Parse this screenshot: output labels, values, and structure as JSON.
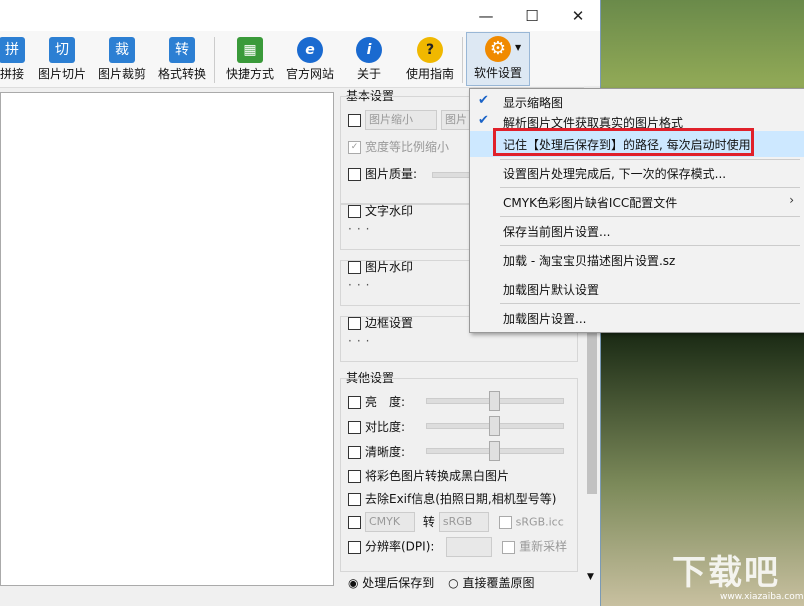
{
  "window": {
    "minimize": "—",
    "maximize": "☐",
    "close": "✕"
  },
  "toolbar": {
    "items": [
      {
        "label": "拼接",
        "icon": "拼",
        "color": "#2c7fd3"
      },
      {
        "label": "图片切片",
        "icon": "切",
        "color": "#2c7fd3"
      },
      {
        "label": "图片裁剪",
        "icon": "裁",
        "color": "#2c7fd3"
      },
      {
        "label": "格式转换",
        "icon": "转",
        "color": "#2c7fd3"
      },
      {
        "label": "快捷方式",
        "icon": "▦",
        "color": "#3a9a3a"
      },
      {
        "label": "官方网站",
        "icon": "e",
        "color": "#1a6ad0"
      },
      {
        "label": "关于",
        "icon": "i",
        "color": "#1a6ad0"
      },
      {
        "label": "使用指南",
        "icon": "?",
        "color": "#f0b800"
      },
      {
        "label": "软件设置",
        "icon": "⚙",
        "color": "#f08a00"
      }
    ]
  },
  "panel": {
    "basic_title": "基本设置",
    "shrink": "图片缩小",
    "shrink2": "图片",
    "keep_ratio": "宽度等比例缩小",
    "quality": "图片质量:",
    "text_watermark": "文字水印",
    "image_watermark": "图片水印",
    "border": "边框设置",
    "dots": "···",
    "other_title": "其他设置",
    "brightness": "亮　度:",
    "contrast": "对比度:",
    "sharpness": "清晰度:",
    "grayscale": "将彩色图片转换成黑白图片",
    "exif": "去除Exif信息(拍照日期,相机型号等)",
    "cmyk": "CMYK",
    "to": "转",
    "srgb": "sRGB",
    "srgb_icc": "sRGB.icc",
    "dpi": "分辨率(DPI):",
    "resample": "重新采样",
    "save_to": "处理后保存到",
    "overwrite": "直接覆盖原图"
  },
  "menu": {
    "items": [
      {
        "label": "显示缩略图",
        "checked": true
      },
      {
        "label": "解析图片文件获取真实的图片格式",
        "checked": true
      },
      {
        "label": "记住【处理后保存到】的路径, 每次启动时使用",
        "checked": false,
        "highlight": true
      },
      {
        "label": "设置图片处理完成后, 下一次的保存模式...",
        "checked": false
      },
      {
        "label": "CMYK色彩图片缺省ICC配置文件",
        "checked": false,
        "submenu": true
      },
      {
        "label": "保存当前图片设置...",
        "checked": false
      },
      {
        "label": "加载 - 淘宝宝贝描述图片设置.sz",
        "checked": false
      },
      {
        "label": "加载图片默认设置",
        "checked": false
      },
      {
        "label": "加载图片设置...",
        "checked": false
      }
    ]
  },
  "watermark": {
    "text": "下载吧",
    "url": "www.xiazaiba.com"
  }
}
